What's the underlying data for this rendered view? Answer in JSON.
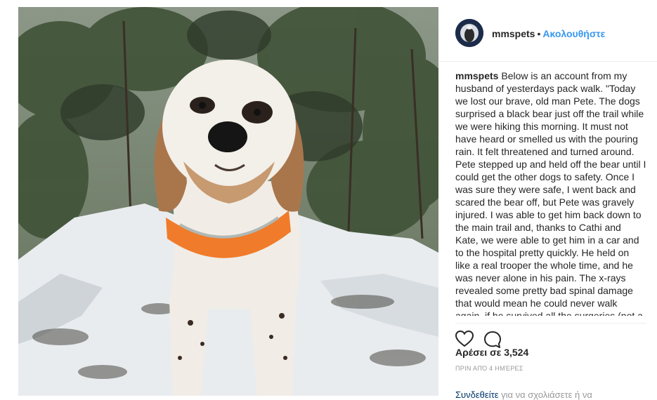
{
  "post": {
    "username": "mmspets",
    "separator": "•",
    "follow_label": "Ακολουθήστε",
    "caption_user": "mmspets",
    "caption_text": "Below is an account from my husband of yesterdays pack walk. \"Today we lost our brave, old man Pete. The dogs surprised a black bear just off the trail while we were hiking this morning. It must not have heard or smelled us with the pouring rain. It felt threatened and turned around. Pete stepped up and held off the bear until I could get the other dogs to safety. Once I was sure they were safe, I went back and scared the bear off, but Pete was gravely injured. I was able to get him back down to the main trail and, thanks to Cathi and Kate, we were able to get him in a car and to the hospital pretty quickly. He held on like a real trooper the whole time, and he was never alone in his pain. The x-rays revealed some pretty bad spinal damage that would mean he could never walk again, if he survived all the surgeries (not a",
    "likes_label": "Αρέσει σε 3,524",
    "time_label": "ΠΡΙΝ ΑΠΌ 4 ΗΜΈΡΕΣ",
    "comment_prompt_link": "Συνδεθείτε",
    "comment_prompt_rest": " για να σχολιάσετε ή να"
  },
  "icons": {
    "like": "heart-icon",
    "comment": "comment-icon"
  }
}
